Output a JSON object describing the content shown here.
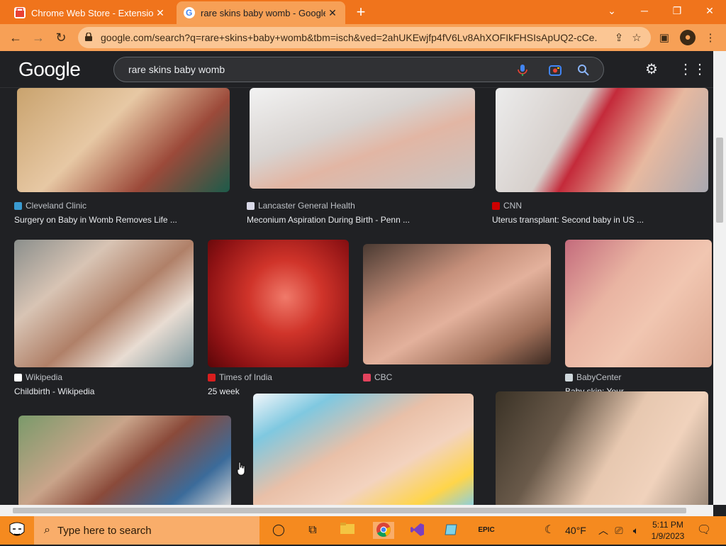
{
  "browser": {
    "tabs": [
      {
        "title": "Chrome Web Store - Extensions",
        "active": false
      },
      {
        "title": "rare skins baby womb - Google S",
        "active": true
      }
    ],
    "url": "google.com/search?q=rare+skins+baby+womb&tbm=isch&ved=2ahUKEwjfp4fV6Lv8AhXOFIkFHSIsApUQ2-cCe..."
  },
  "search": {
    "logo": "Google",
    "query": "rare skins baby womb"
  },
  "results": [
    {
      "source": "Cleveland Clinic",
      "title": "Surgery on Baby in Womb Removes Life ..."
    },
    {
      "source": "Lancaster General Health",
      "title": "Meconium Aspiration During Birth - Penn ..."
    },
    {
      "source": "CNN",
      "title": "Uterus transplant: Second baby in US ..."
    },
    {
      "source": "Wikipedia",
      "title": "Childbirth - Wikipedia"
    },
    {
      "source": "Times of India",
      "title": "25 week"
    },
    {
      "source": "CBC",
      "title": ""
    },
    {
      "source": "BabyCenter",
      "title": "Baby skin: Your"
    }
  ],
  "taskbar": {
    "search_placeholder": "Type here to search",
    "weather": "40°F",
    "time": "5:11 PM",
    "date": "1/9/2023"
  },
  "colors": {
    "tabbar": "#f0741c",
    "toolbar": "#f7a056",
    "page_bg": "#202124",
    "taskbar": "#f58a1f"
  }
}
